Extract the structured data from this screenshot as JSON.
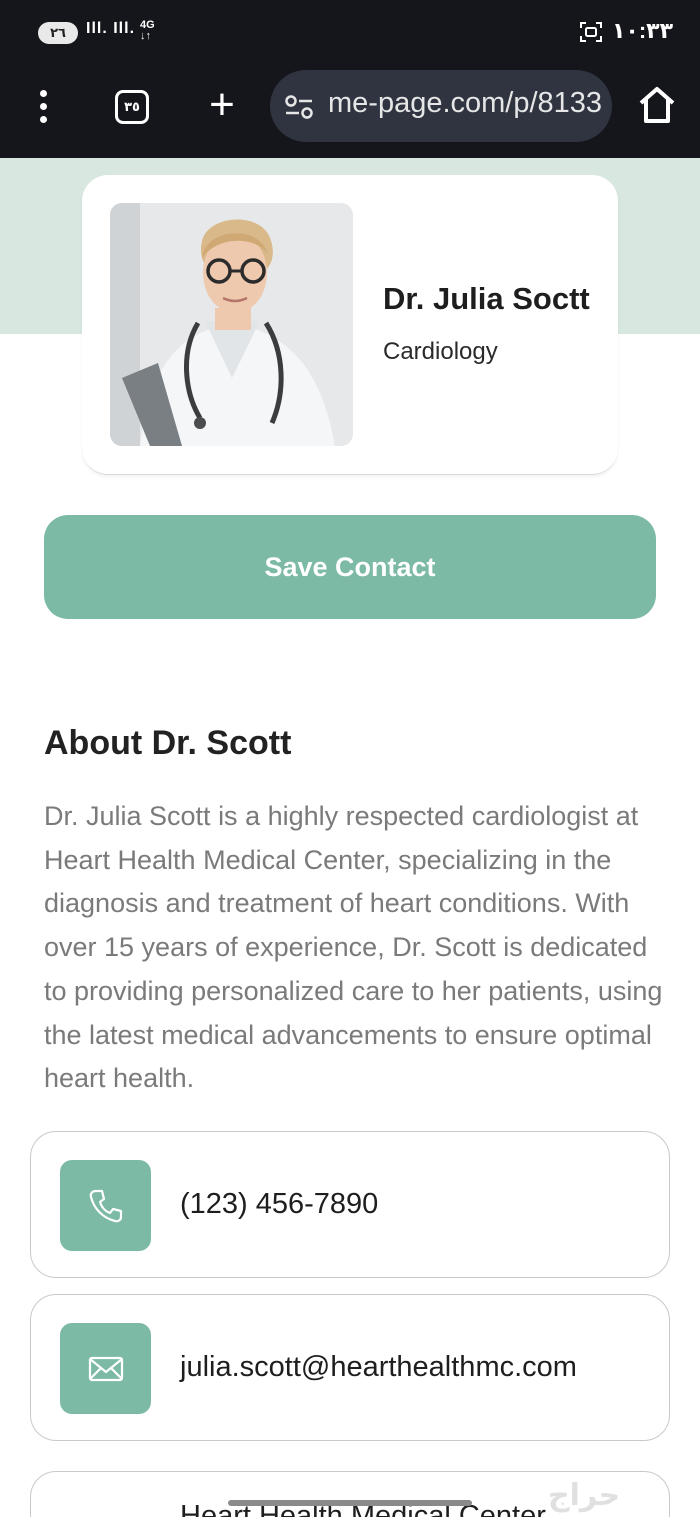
{
  "status_bar": {
    "battery": "٢٦",
    "network": "4G",
    "time": "١٠:٣٣"
  },
  "browser": {
    "tab_count": "٣٥",
    "url": "me-page.com/p/8133"
  },
  "profile": {
    "name": "Dr. Julia Soctt",
    "specialty": "Cardiology"
  },
  "actions": {
    "save_label": "Save Contact"
  },
  "about": {
    "title": "About Dr. Scott",
    "body": "Dr. Julia Scott is a highly respected cardiologist at Heart Health Medical Center, specializing in the diagnosis and treatment of heart conditions. With over 15 years of experience, Dr. Scott is dedicated to providing personalized care to her patients, using the latest medical advancements to ensure optimal heart health."
  },
  "contacts": {
    "phone": "(123) 456-7890",
    "email": "julia.scott@hearthealthmc.com",
    "address": "Heart Health Medical Center"
  },
  "colors": {
    "accent": "#7cbaa5",
    "hero_band": "#d8e7e0",
    "chrome": "#14161b"
  },
  "icons": [
    "kebab-menu-icon",
    "tabs-icon",
    "plus-icon",
    "site-settings-icon",
    "home-icon",
    "phone-icon",
    "mail-icon",
    "screen-record-icon"
  ]
}
